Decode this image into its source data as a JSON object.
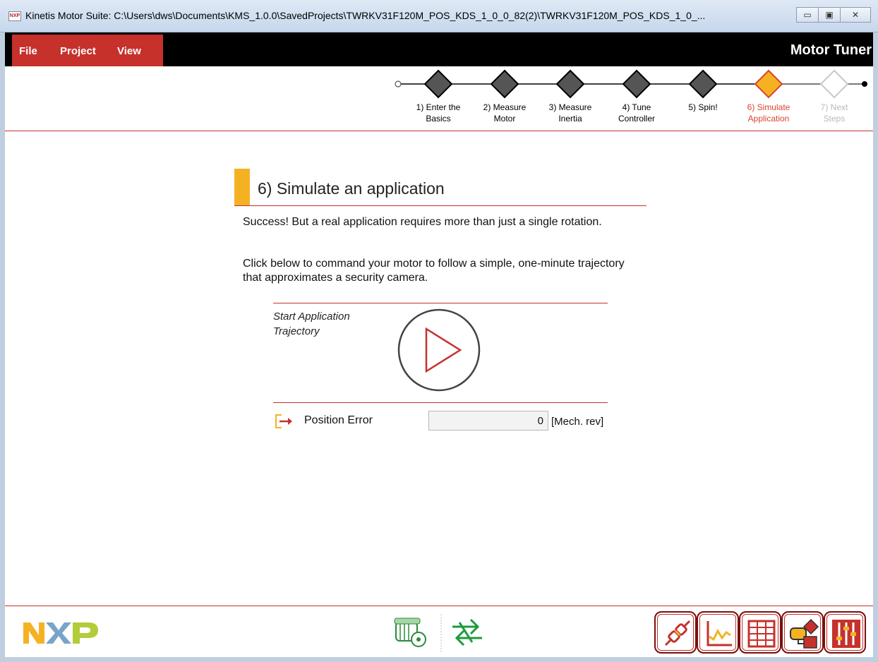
{
  "window": {
    "title": "Kinetis Motor Suite: C:\\Users\\dws\\Documents\\KMS_1.0.0\\SavedProjects\\TWRKV31F120M_POS_KDS_1_0_0_82(2)\\TWRKV31F120M_POS_KDS_1_0_...",
    "icon_text": "NXP",
    "minimize_icon": "▭",
    "maximize_icon": "▣",
    "close_icon": "✕"
  },
  "menu": {
    "file": "File",
    "project": "Project",
    "view": "View",
    "app_title": "Motor Tuner"
  },
  "steps": [
    {
      "line1": "1) Enter the",
      "line2": "Basics",
      "state": "done"
    },
    {
      "line1": "2) Measure",
      "line2": "Motor",
      "state": "done"
    },
    {
      "line1": "3) Measure",
      "line2": "Inertia",
      "state": "done"
    },
    {
      "line1": "4) Tune",
      "line2": "Controller",
      "state": "done"
    },
    {
      "line1": "5) Spin!",
      "line2": "",
      "state": "done"
    },
    {
      "line1": "6) Simulate",
      "line2": "Application",
      "state": "active"
    },
    {
      "line1": "7) Next",
      "line2": "Steps",
      "state": "disabled"
    }
  ],
  "content": {
    "title": "6) Simulate an application",
    "para1": "Success! But a real application requires more than just a single rotation.",
    "para2": "Click below to command your motor to follow a simple, one-minute trajectory that approximates a security camera.",
    "start_label_line1": "Start Application",
    "start_label_line2": "Trajectory",
    "position_error_label": "Position Error",
    "position_error_value": "0",
    "position_error_unit": "[Mech. rev]"
  },
  "colors": {
    "brand_red": "#c6312c",
    "active_orange": "#f4b223",
    "step_done": "#555555"
  },
  "footer": {
    "logo": "nxp-logo",
    "tools": [
      "connection-icon",
      "scope-icon",
      "grid-table-icon",
      "flowchart-icon",
      "sliders-icon"
    ]
  }
}
